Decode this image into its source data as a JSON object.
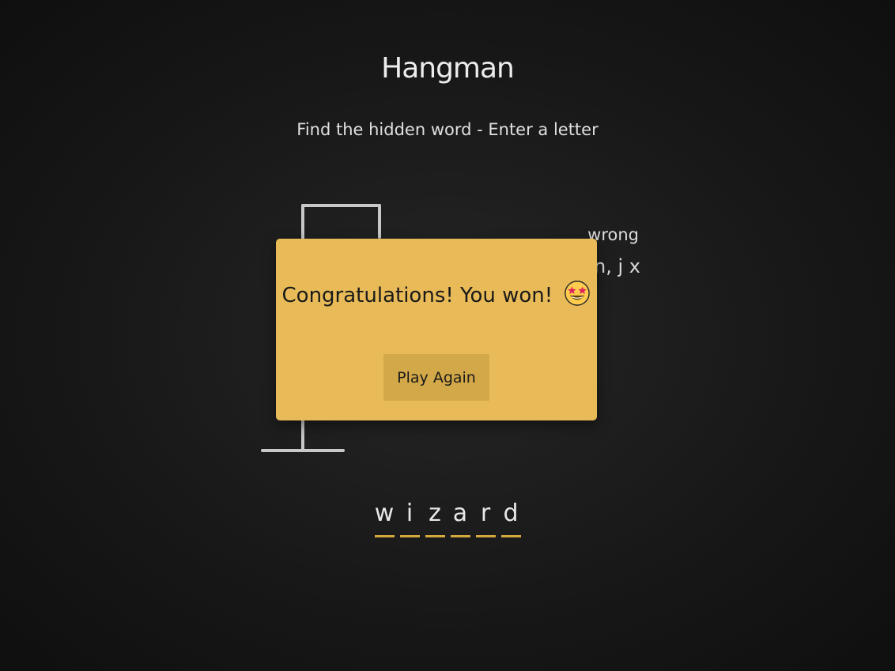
{
  "header": {
    "title": "Hangman",
    "subtitle": "Find the hidden word - Enter a letter"
  },
  "wrong": {
    "label": "wrong",
    "letters": "n, j x"
  },
  "word": {
    "letters": [
      "w",
      "i",
      "z",
      "a",
      "r",
      "d"
    ]
  },
  "popup": {
    "message": "Congratulations! You won!",
    "emoji_icon": "star-struck-emoji",
    "button_label": "Play Again"
  },
  "colors": {
    "popup_bg": "#e8bb58",
    "button_bg": "#d3a848",
    "underline": "#d4a83c",
    "figure_line": "#c8c8c8"
  }
}
